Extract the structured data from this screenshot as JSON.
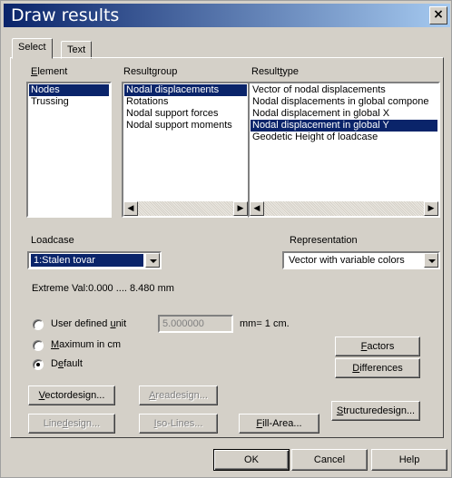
{
  "window": {
    "title": "Draw results",
    "close_symbol": "×"
  },
  "tabs": [
    {
      "label": "Select",
      "active": true
    },
    {
      "label": "Text",
      "active": false
    }
  ],
  "element": {
    "label_prefix": "",
    "label_underlined": "E",
    "label_rest": "lement",
    "items": [
      {
        "label": "Nodes",
        "selected": true
      },
      {
        "label": "Trussing",
        "selected": false
      }
    ]
  },
  "resultgroup": {
    "label": "Resultgroup",
    "items": [
      {
        "label": "Nodal displacements",
        "selected": true
      },
      {
        "label": "Rotations",
        "selected": false
      },
      {
        "label": "Nodal support forces",
        "selected": false
      },
      {
        "label": "Nodal support moments",
        "selected": false
      }
    ]
  },
  "resulttype": {
    "label_prefix": "Result",
    "label_underlined": "t",
    "label_rest": "ype",
    "items": [
      {
        "label": "Vector of nodal displacements",
        "selected": false
      },
      {
        "label": "Nodal displacements in global compone",
        "selected": false
      },
      {
        "label": "Nodal displacement in global X",
        "selected": false
      },
      {
        "label": "Nodal displacement in global Y",
        "selected": true
      },
      {
        "label": "Geodetic Height of loadcase",
        "selected": false
      }
    ]
  },
  "loadcase": {
    "label": "Loadcase",
    "value": "1:Stalen tovar"
  },
  "representation": {
    "label": "Representation",
    "value": "Vector with variable colors"
  },
  "extreme": {
    "text": "Extreme Val:0.000 .... 8.480  mm"
  },
  "scale_options": {
    "user_defined": {
      "prefix": "User defined ",
      "underlined": "u",
      "rest": "nit",
      "selected": false
    },
    "user_value": "5.000000",
    "user_suffix": "mm= 1 cm.",
    "maximum": {
      "prefix": "",
      "underlined": "M",
      "rest": "aximum in cm",
      "selected": false
    },
    "default": {
      "prefix": "D",
      "underlined": "e",
      "rest": "fault",
      "selected": true
    }
  },
  "buttons": {
    "factors": {
      "prefix": "",
      "underlined": "F",
      "rest": "actors"
    },
    "differences": {
      "prefix": "",
      "underlined": "D",
      "rest": "ifferences"
    },
    "vectordesign": {
      "prefix": "",
      "underlined": "V",
      "rest": "ectordesign..."
    },
    "areadesign": {
      "prefix": "",
      "underlined": "A",
      "rest": "readesign..."
    },
    "linedesign": {
      "prefix": "Line",
      "underlined": "d",
      "rest": "esign..."
    },
    "isolines": {
      "prefix": "",
      "underlined": "I",
      "rest": "so-Lines..."
    },
    "fillarea": {
      "prefix": "",
      "underlined": "F",
      "rest": "ill-Area..."
    },
    "structuredesign": {
      "prefix": "",
      "underlined": "S",
      "rest": "tructuredesign..."
    },
    "ok": "OK",
    "cancel": "Cancel",
    "help": "Help"
  },
  "colors": {
    "title_start": "#0a246a",
    "title_end": "#a6caf0",
    "selection": "#0a246a",
    "face": "#d4d0c8"
  },
  "icons": [
    "close-icon",
    "scroll-left-icon",
    "scroll-right-icon",
    "dropdown-arrow-icon"
  ]
}
